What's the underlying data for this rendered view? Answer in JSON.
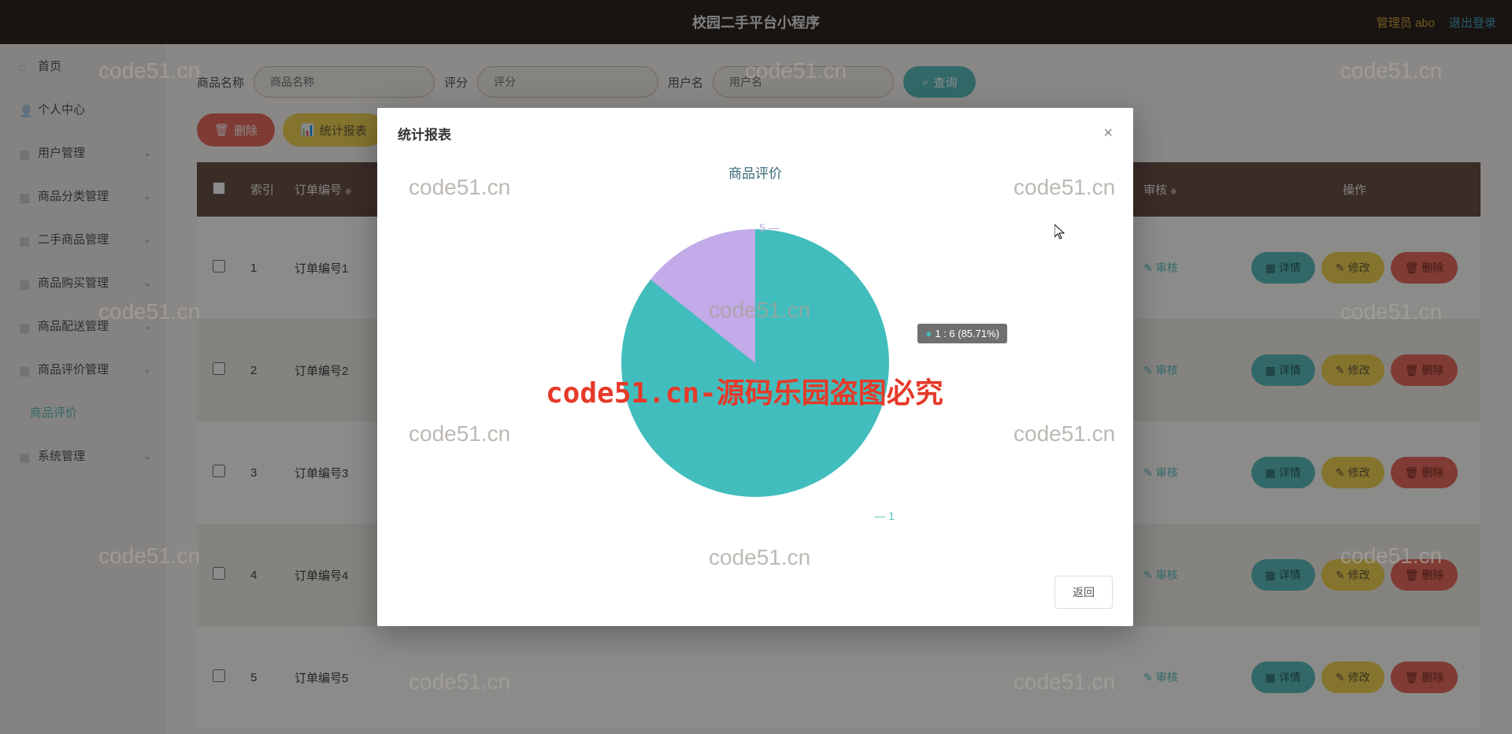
{
  "header": {
    "title": "校园二手平台小程序",
    "admin_label": "管理员 abo",
    "logout": "退出登录"
  },
  "sidebar": {
    "items": [
      {
        "label": "首页"
      },
      {
        "label": "个人中心"
      },
      {
        "label": "用户管理"
      },
      {
        "label": "商品分类管理"
      },
      {
        "label": "二手商品管理"
      },
      {
        "label": "商品购买管理"
      },
      {
        "label": "商品配送管理"
      },
      {
        "label": "商品评价管理"
      },
      {
        "label": "商品评价"
      },
      {
        "label": "系统管理"
      }
    ]
  },
  "filter": {
    "name_label": "商品名称",
    "name_placeholder": "商品名称",
    "score_label": "评分",
    "score_placeholder": "评分",
    "user_label": "用户名",
    "user_placeholder": "用户名",
    "query_btn": "查询"
  },
  "actions": {
    "delete": "删除",
    "stats": "统计报表"
  },
  "table": {
    "cols": {
      "index": "索引",
      "order_no": "订单编号",
      "audit": "审核",
      "ops": "操作"
    },
    "audit_link": "审核",
    "btns": {
      "detail": "详情",
      "edit": "修改",
      "delete": "删除"
    },
    "rows": [
      {
        "idx": "1",
        "order": "订单编号1"
      },
      {
        "idx": "2",
        "order": "订单编号2"
      },
      {
        "idx": "3",
        "order": "订单编号3"
      },
      {
        "idx": "4",
        "order": "订单编号4"
      },
      {
        "idx": "5",
        "order": "订单编号5"
      }
    ]
  },
  "modal": {
    "title": "统计报表",
    "chart_title": "商品评价",
    "tooltip": "1 : 6 (85.71%)",
    "back": "返回",
    "label5": "5",
    "label1": "1"
  },
  "chart_data": {
    "type": "pie",
    "title": "商品评价",
    "series": [
      {
        "name": "1",
        "value": 6,
        "percent": 85.71,
        "color": "#42bdbd"
      },
      {
        "name": "5",
        "value": 1,
        "percent": 14.29,
        "color": "#c3aae8"
      }
    ]
  },
  "watermarks": {
    "text": "code51.cn",
    "red": "code51.cn-源码乐园盗图必究"
  }
}
